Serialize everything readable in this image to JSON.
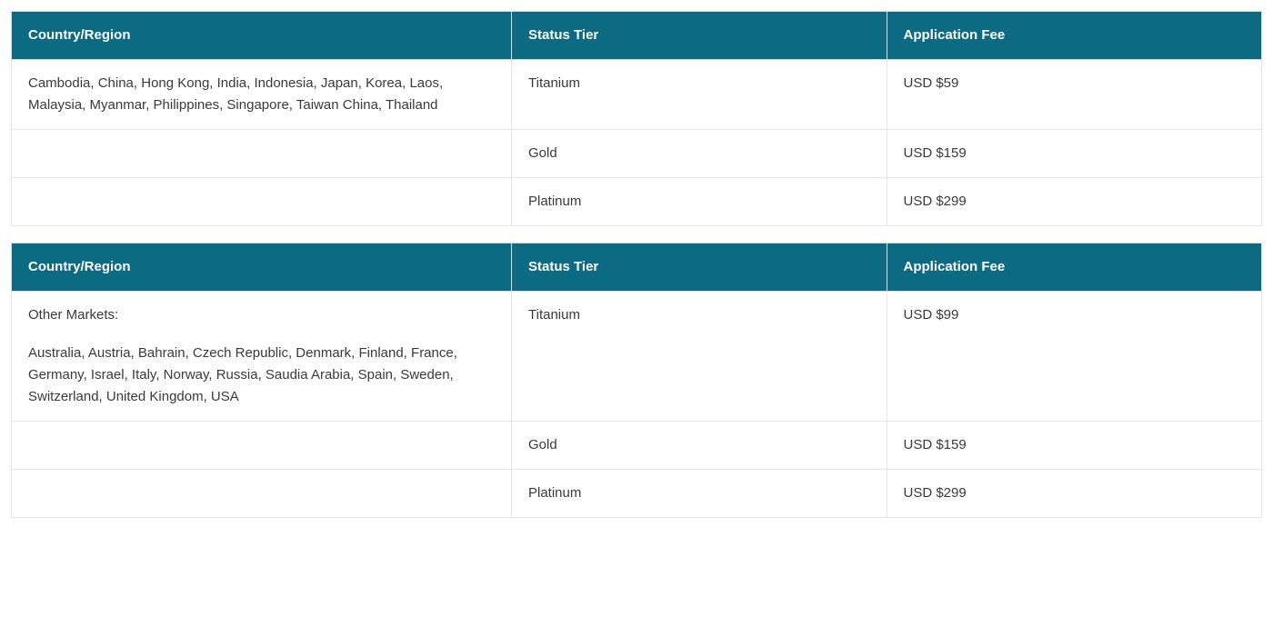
{
  "columns": {
    "country": "Country/Region",
    "tier": "Status Tier",
    "fee": "Application Fee"
  },
  "tables": [
    {
      "rows": [
        {
          "country_lead": "",
          "country": "Cambodia, China, Hong Kong, India, Indonesia, Japan, Korea, Laos, Malaysia, Myanmar, Philippines, Singapore, Taiwan China, Thailand",
          "tier": "Titanium",
          "fee": "USD $59"
        },
        {
          "country_lead": "",
          "country": "",
          "tier": "Gold",
          "fee": "USD $159"
        },
        {
          "country_lead": "",
          "country": "",
          "tier": "Platinum",
          "fee": "USD $299"
        }
      ]
    },
    {
      "rows": [
        {
          "country_lead": "Other Markets:",
          "country": "Australia, Austria, Bahrain, Czech Republic, Denmark, Finland, France, Germany, Israel, Italy, Norway, Russia, Saudia Arabia, Spain, Sweden, Switzerland, United Kingdom, USA",
          "tier": "Titanium",
          "fee": "USD $99"
        },
        {
          "country_lead": "",
          "country": "",
          "tier": "Gold",
          "fee": "USD $159"
        },
        {
          "country_lead": "",
          "country": "",
          "tier": "Platinum",
          "fee": "USD $299"
        }
      ]
    }
  ]
}
